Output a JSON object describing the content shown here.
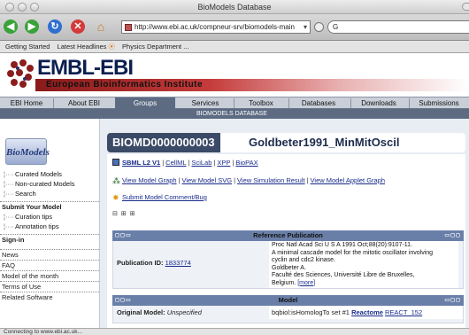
{
  "window": {
    "title": "BioModels Database"
  },
  "toolbar": {
    "url": "http://www.ebi.ac.uk/compneur-srv/biomodels-main",
    "search_placeholder": "G"
  },
  "bookmarks": [
    "Getting Started",
    "Latest Headlines",
    "Physics Department ..."
  ],
  "banner": {
    "logo": "EMBL-EBI",
    "institute": "European Bioinformatics Institute"
  },
  "nav": {
    "tabs": [
      "EBI Home",
      "About EBI",
      "Groups",
      "Services",
      "Toolbox",
      "Databases",
      "Downloads",
      "Submissions"
    ],
    "subtitle": "BIOMODELS DATABASE"
  },
  "sidebar": {
    "logo": "BioModels",
    "items": [
      "Curated Models",
      "Non-curated Models",
      "Search"
    ],
    "submit_head": "Submit Your Model",
    "submit_items": [
      "Curation tips",
      "Annotation tips"
    ],
    "links": [
      "Sign-in",
      "News",
      "FAQ",
      "Model of the month",
      "Terms of Use",
      "Related Software"
    ]
  },
  "model": {
    "id": "BIOMD0000000003",
    "name": "Goldbeter1991_MinMitOscil"
  },
  "formats": {
    "sbml": "SBML L2 V1",
    "cellml": "CellML",
    "scilab": "SciLab",
    "xpp": "XPP",
    "biopax": "BioPAX"
  },
  "views": {
    "graph": "View Model Graph",
    "svg": "View Model SVG",
    "sim": "View Simulation Result",
    "applet": "View Model Applet Graph"
  },
  "comment": "Submit Model Comment/Bug",
  "minibtns": "⊟ ⊞ ⊞",
  "ref": {
    "head": "Reference Publication",
    "label": "Publication ID:",
    "pubid": "1833774",
    "lines": [
      "Proc Natl Acad Sci U S A 1991 Oct;88(20):9107-11.",
      "A minimal cascade model for the mitotic oscillator involving",
      "cyclin and cdc2 kinase.",
      "Goldbeter A.",
      "Faculté des Sciences, Université Libre de Bruxelles,",
      "Belgium."
    ],
    "more": "[more]"
  },
  "model_sec": {
    "head": "Model",
    "label": "Original Model:",
    "unspec": "Unspecified",
    "right_text": "bqbiol:isHomologTo set #1",
    "reactome": "Reactome",
    "reactome_id": "REACT_152"
  },
  "status": "Connecting to www.ebi.ac.uk..."
}
